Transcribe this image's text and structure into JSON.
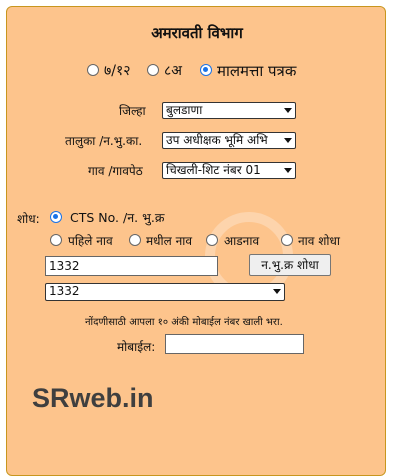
{
  "title": "अमरावती विभाग",
  "record_types": [
    {
      "label": "७/१२",
      "selected": false
    },
    {
      "label": "८अ",
      "selected": false
    },
    {
      "label": "मालमत्ता पत्रक",
      "selected": true
    }
  ],
  "fields": {
    "district": {
      "label": "जिल्हा",
      "value": "बुलडाणा"
    },
    "taluka": {
      "label": "तालुका /न.भु.का.",
      "value": "उप अधीक्षक भूमि अभि"
    },
    "village": {
      "label": "गाव /गावपेठ",
      "value": "चिखली-शिट नंबर 01"
    }
  },
  "search": {
    "label": "शोध:",
    "options": [
      {
        "label": "CTS No. /न. भु.क्र",
        "selected": true
      },
      {
        "label": "पहिले नाव",
        "selected": false
      },
      {
        "label": "मधील नाव",
        "selected": false
      },
      {
        "label": "आडनाव",
        "selected": false
      },
      {
        "label": "नाव शोधा",
        "selected": false
      }
    ],
    "input_value": "1332",
    "button_label": "न.भु.क्र शोधा",
    "result_value": "1332"
  },
  "mobile": {
    "note": "नोंदणीसाठी आपला १० अंकी मोबाईल नंबर खाली भरा.",
    "label": "मोबाईल:",
    "value": ""
  },
  "brand": "SRweb.in",
  "colors": {
    "panel": "#fdc48c",
    "border": "#c8961e",
    "radio_accent": "#1a73e8"
  }
}
